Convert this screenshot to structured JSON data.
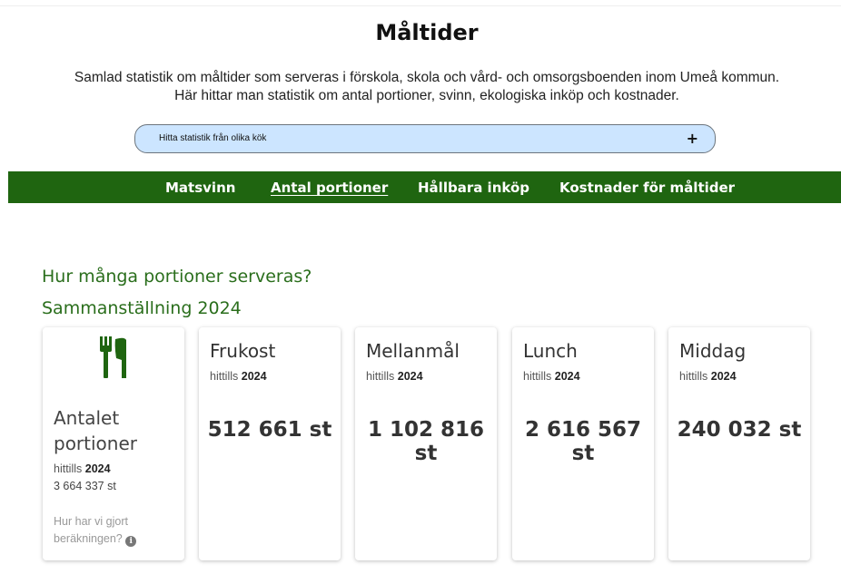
{
  "header": {
    "title": "Måltider",
    "subtitle_line1": "Samlad statistik om måltider som serveras i förskola, skola och vård- och omsorgsboenden inom Umeå kommun.",
    "subtitle_line2": "Här hittar man statistik om antal portioner, svinn, ekologiska inköp och kostnader."
  },
  "kitchen_selector": {
    "label": "Hitta statistik från olika kök",
    "icon": "plus-icon",
    "background": "#cce5ff"
  },
  "nav": {
    "background": "#1f6510",
    "items": [
      {
        "label": "Matsvinn"
      },
      {
        "label": "Antal portioner",
        "active": true
      },
      {
        "label": "Hållbara inköp"
      },
      {
        "label": "Kostnader för måltider"
      }
    ]
  },
  "section": {
    "question": "Hur många portioner serveras?",
    "summary": "Sammanställning 2024"
  },
  "main_card": {
    "icon": "cutlery-icon",
    "icon_color": "#1f6510",
    "title": "Antalet portioner",
    "hittills_label": "hittills",
    "year": "2024",
    "total": "3 664 337 st",
    "howcalc": "Hur har vi gjort beräkningen?",
    "info_icon": "info-icon"
  },
  "meal_cards": [
    {
      "title": "Frukost",
      "hittills_label": "hittills",
      "year": "2024",
      "value": "512 661 st"
    },
    {
      "title": "Mellanmål",
      "hittills_label": "hittills",
      "year": "2024",
      "value": "1 102 816 st"
    },
    {
      "title": "Lunch",
      "hittills_label": "hittills",
      "year": "2024",
      "value": "2 616 567 st"
    },
    {
      "title": "Middag",
      "hittills_label": "hittills",
      "year": "2024",
      "value": "240 032 st"
    }
  ]
}
